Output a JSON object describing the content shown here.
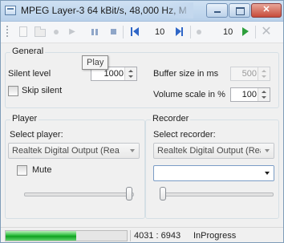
{
  "window": {
    "title": "MPEG Layer-3 64 kBit/s, 48,000 Hz, M"
  },
  "toolbar": {
    "position_value": "10",
    "end_value": "10",
    "tooltip": "Play"
  },
  "general": {
    "legend": "General",
    "silent_level_label": "Silent level",
    "silent_level_value": "1000",
    "skip_silent_label": "Skip silent",
    "skip_silent_checked": false,
    "buffer_size_label": "Buffer size in ms",
    "buffer_size_value": "500",
    "volume_scale_label": "Volume scale in %",
    "volume_scale_value": "100"
  },
  "player": {
    "legend": "Player",
    "select_label": "Select player:",
    "selected_device": "Realtek Digital Output (Rea",
    "mute_label": "Mute",
    "mute_checked": false,
    "volume_level": 1.0
  },
  "recorder": {
    "legend": "Recorder",
    "select_label": "Select recorder:",
    "selected_device": "Realtek Digital Output (Rea",
    "second_select_value": "",
    "level": 0.0
  },
  "status": {
    "progress_fraction": 0.58,
    "position_text": "4031 : 6943",
    "state_text": "InProgress"
  },
  "colors": {
    "progress_green": "#2fbd3f",
    "accent_blue": "#2f66c7",
    "play_green": "#2e9f3c"
  }
}
